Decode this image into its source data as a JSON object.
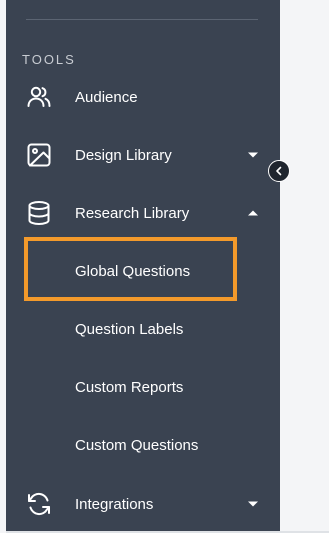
{
  "sidebar": {
    "section_title": "TOOLS",
    "items": [
      {
        "label": "Audience",
        "icon": "users-icon"
      },
      {
        "label": "Design Library",
        "icon": "image-icon",
        "caret": "down"
      },
      {
        "label": "Research Library",
        "icon": "database-icon",
        "caret": "up"
      },
      {
        "label": "Integrations",
        "icon": "sync-icon",
        "caret": "down"
      }
    ],
    "research_sub_items": [
      {
        "label": "Global Questions",
        "selected": true
      },
      {
        "label": "Question Labels"
      },
      {
        "label": "Custom Reports"
      },
      {
        "label": "Custom Questions"
      }
    ]
  },
  "colors": {
    "sidebar_bg": "#3a4351",
    "highlight": "#f39a2b",
    "text": "#ffffff"
  }
}
